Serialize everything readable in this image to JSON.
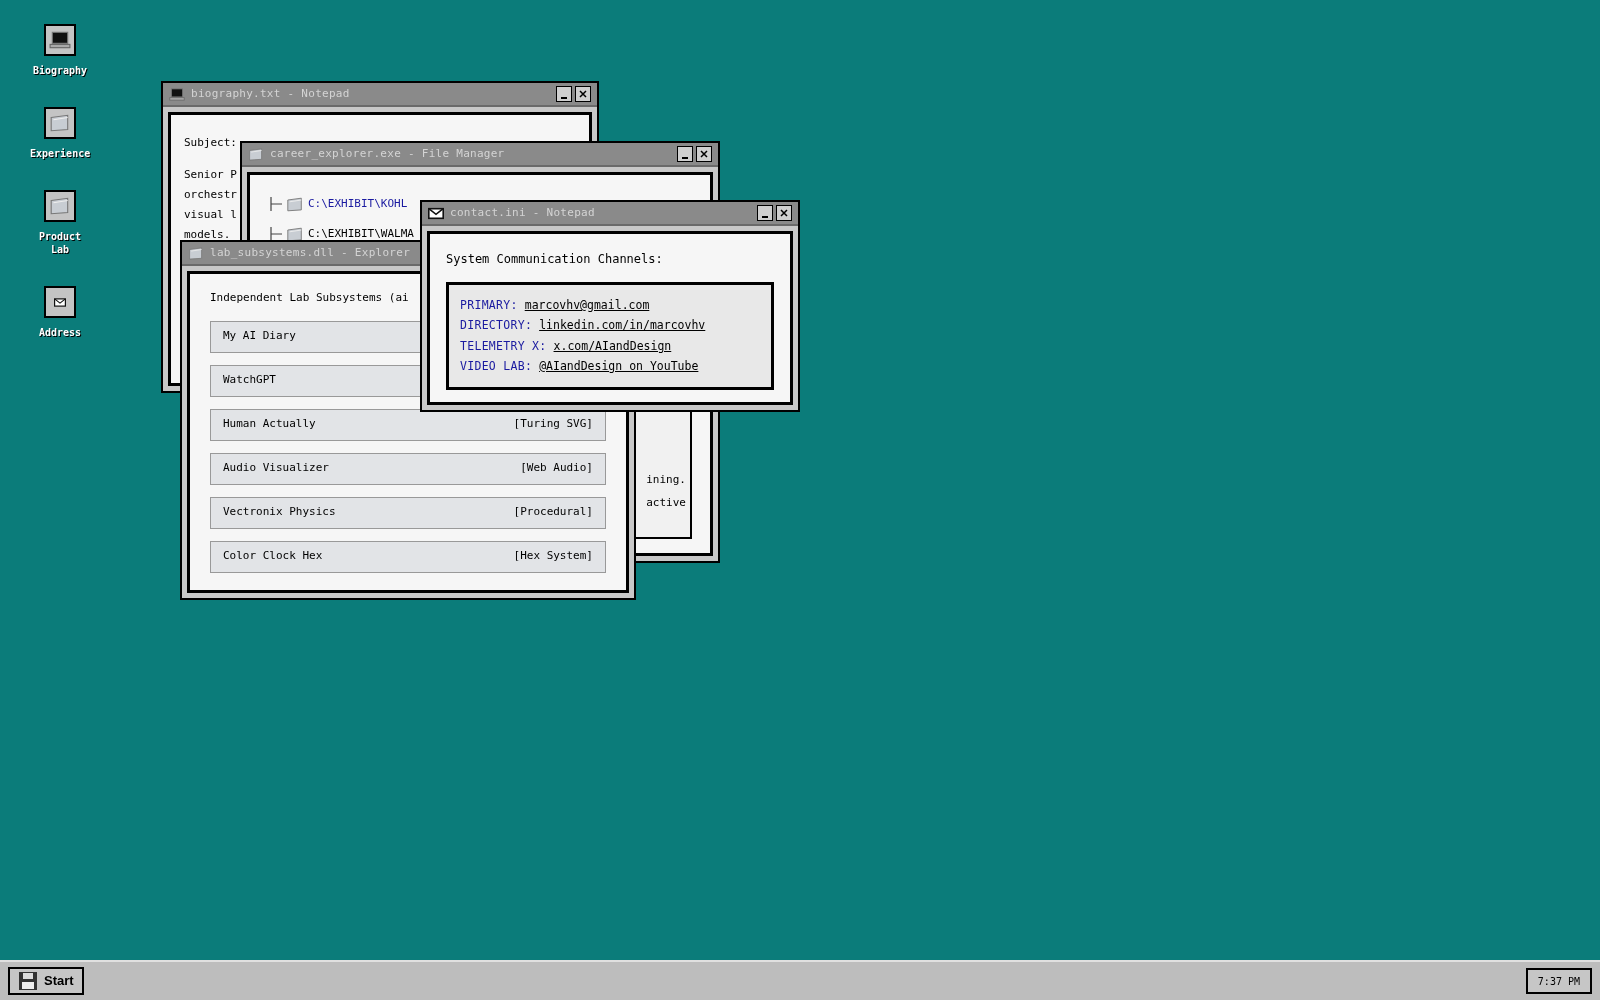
{
  "desktop_icons": [
    {
      "label": "Biography",
      "kind": "laptop"
    },
    {
      "label": "Experience",
      "kind": "folder"
    },
    {
      "label": "Product Lab",
      "kind": "folder"
    },
    {
      "label": "Address",
      "kind": "envelope"
    }
  ],
  "windows": [
    {
      "kind": "biography",
      "title": "biography.txt - Notepad",
      "lines": [
        "Subject:",
        "Senior P",
        "orchestr",
        "visual l",
        "models."
      ]
    },
    {
      "kind": "file_manager",
      "title": "career_explorer.exe - File Manager",
      "tree": [
        {
          "path": "C:\\EXHIBIT\\KOHL",
          "selected": true
        },
        {
          "path": "C:\\EXHIBIT\\WALMA",
          "selected": false
        }
      ],
      "panel_lines": [
        "ining.",
        "active"
      ]
    },
    {
      "kind": "explorer",
      "title": "lab_subsystems.dll - Explorer",
      "heading": "Independent Lab Subsystems (ai",
      "items": [
        {
          "name": "My AI Diary"
        },
        {
          "name": "WatchGPT"
        },
        {
          "name": "Human Actually",
          "tag": "[Turing SVG]"
        },
        {
          "name": "Audio Visualizer",
          "tag": "[Web Audio]"
        },
        {
          "name": "Vectronix Physics",
          "tag": "[Procedural]"
        },
        {
          "name": "Color Clock Hex",
          "tag": "[Hex System]"
        }
      ]
    },
    {
      "kind": "contact",
      "title": "contact.ini - Notepad",
      "heading": "System Communication Channels:",
      "channels": [
        {
          "label": "PRIMARY:",
          "value": "marcovhv@gmail.com"
        },
        {
          "label": "DIRECTORY:",
          "value": "linkedin.com/in/marcovhv"
        },
        {
          "label": "TELEMETRY X:",
          "value": "x.com/AIandDesign"
        },
        {
          "label": "VIDEO LAB:",
          "value": "@AIandDesign on YouTube"
        }
      ]
    }
  ],
  "taskbar": {
    "start": "Start",
    "clock": "7:37 PM"
  }
}
